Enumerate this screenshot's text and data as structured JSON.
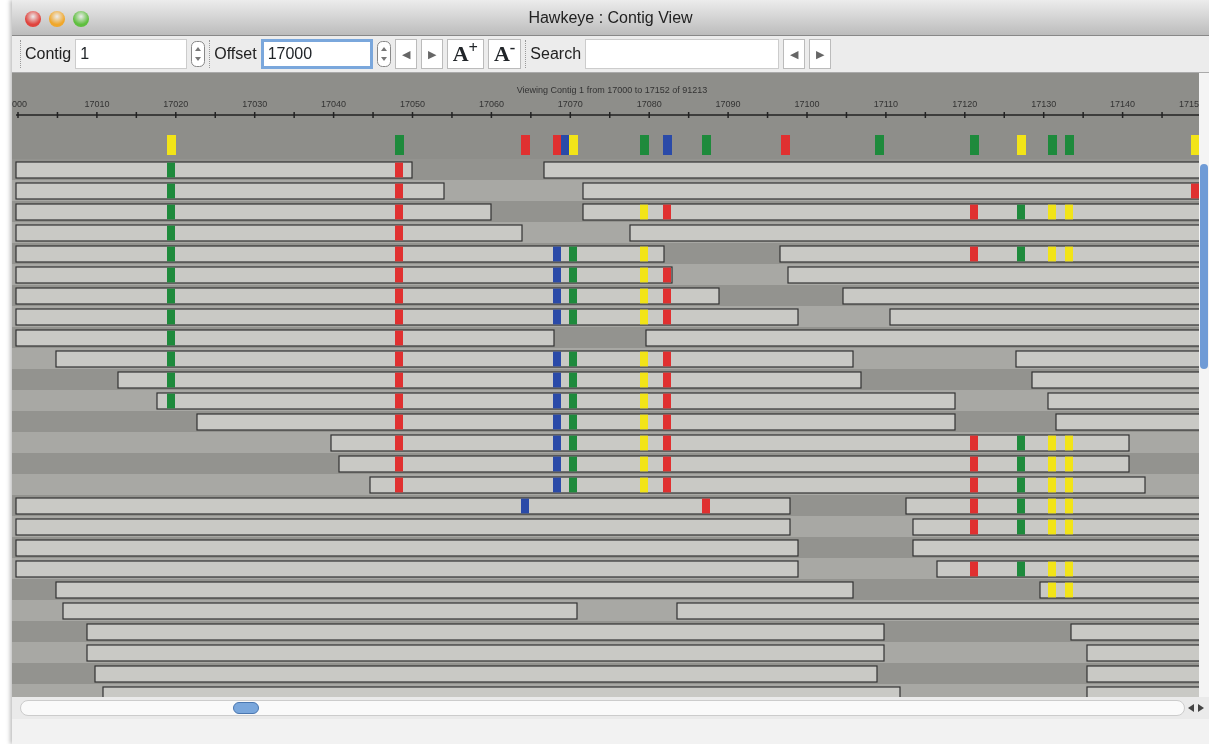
{
  "window": {
    "title": "Hawkeye : Contig View"
  },
  "toolbar": {
    "fields": [
      {
        "label": "Contig",
        "value": "1",
        "focused": false
      },
      {
        "label": "Offset",
        "value": "17000",
        "focused": true
      }
    ],
    "nav_buttons": [
      "◀",
      "▶"
    ],
    "font_buttons": [
      "A$^{+}$",
      "A$^{-}$"
    ],
    "search": {
      "label": "Search"
    },
    "search_nav_buttons": [
      "◀",
      "▶"
    ]
  },
  "contig_view": {
    "caption": "Viewing Contig 1 from 17000 to 17152 of 91213",
    "ruler_labels": [
      "000",
      "17010",
      "17020",
      "17030",
      "17040",
      "17050",
      "17060",
      "17070",
      "17080",
      "17090",
      "17100",
      "17110",
      "17120",
      "17130",
      "17140",
      "1715"
    ]
  }
}
